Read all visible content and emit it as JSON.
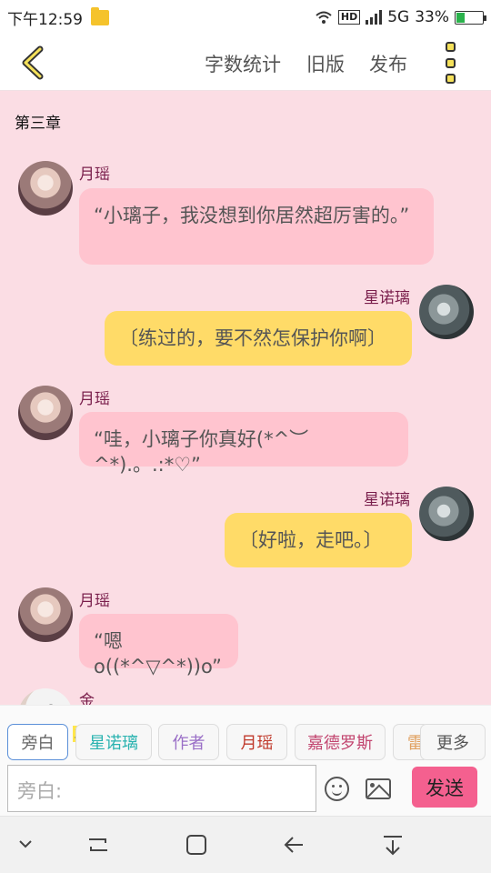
{
  "status_bar": {
    "time": "下午12:59",
    "network_label": "HD",
    "network_type": "5G",
    "battery": "33%",
    "battery_level": 0.33
  },
  "header": {
    "word_count_label": "字数统计",
    "old_version_label": "旧版",
    "publish_label": "发布"
  },
  "chapter_title": "第三章",
  "messages": [
    {
      "sender": "月瑶",
      "side": "left",
      "text": "“小璃子，我没想到你居然超厉害的。”"
    },
    {
      "sender": "星诺璃",
      "side": "right",
      "text": "〔练过的，要不然怎保护你啊〕"
    },
    {
      "sender": "月瑶",
      "side": "left",
      "text": "“哇，小璃子你真好(*^︶^*).。.:*♡”"
    },
    {
      "sender": "星诺璃",
      "side": "right",
      "text": "〔好啦，走吧。〕"
    },
    {
      "sender": "月瑶",
      "side": "left",
      "text": "“嗯o((*^▽^*))o”"
    },
    {
      "sender": "金",
      "side": "left",
      "text": ""
    }
  ],
  "roles": {
    "narration": "旁白",
    "main_badge": "主",
    "r1": "星诺璃",
    "r2": "作者",
    "r3": "月瑶",
    "r4": "嘉德罗斯",
    "r5": "雷",
    "more": "更多"
  },
  "input": {
    "placeholder": "旁白:"
  },
  "send_label": "发送",
  "colors": {
    "background": "#fbdde4",
    "left_bubble": "#ffc4cf",
    "right_bubble": "#ffdb68",
    "send_button": "#f4608f",
    "sender_name": "#7a1f4c"
  }
}
